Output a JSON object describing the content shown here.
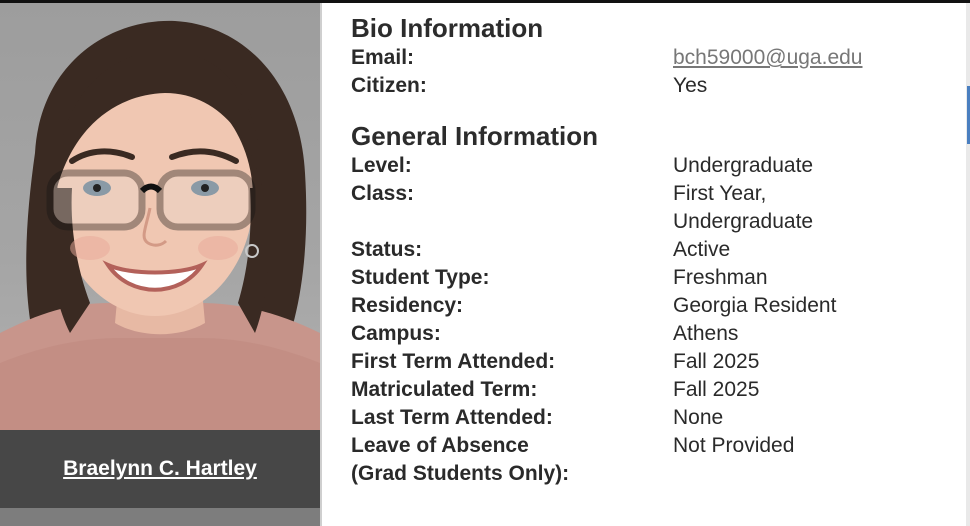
{
  "profile": {
    "name": "Braelynn C. Hartley"
  },
  "bio": {
    "title": "Bio Information",
    "rows": [
      {
        "label": "Email:",
        "value": "bch59000@uga.edu"
      },
      {
        "label": "Citizen:",
        "value": "Yes"
      }
    ]
  },
  "general": {
    "title": "General Information",
    "rows": [
      {
        "label": "Level:",
        "value": "Undergraduate"
      },
      {
        "label": "Class:",
        "value": "First Year,"
      },
      {
        "label": "",
        "value": "Undergraduate"
      },
      {
        "label": "Status:",
        "value": "Active"
      },
      {
        "label": "Student Type:",
        "value": "Freshman"
      },
      {
        "label": "Residency:",
        "value": "Georgia Resident"
      },
      {
        "label": "Campus:",
        "value": "Athens"
      },
      {
        "label": "First Term Attended:",
        "value": "Fall 2025"
      },
      {
        "label": "Matriculated Term:",
        "value": "Fall 2025"
      },
      {
        "label": "Last Term Attended:",
        "value": "None"
      },
      {
        "label": "Leave of Absence",
        "value": "Not Provided"
      },
      {
        "label": "(Grad Students Only):",
        "value": ""
      }
    ]
  },
  "colors": {
    "name_bar": "#474747",
    "link": "#777777",
    "photo_background": "#9d9d9d"
  }
}
